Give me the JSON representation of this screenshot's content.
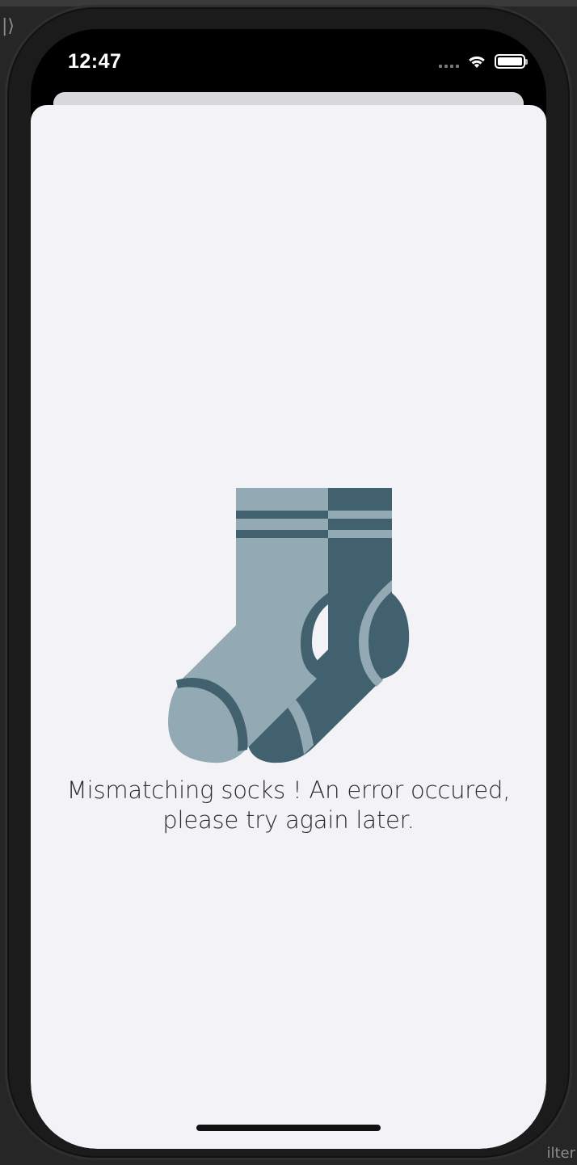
{
  "status_bar": {
    "time": "12:47",
    "signal_icon": "signal-dots-icon",
    "wifi_icon": "wifi-icon",
    "battery_icon": "battery-full-icon"
  },
  "error_state": {
    "illustration_icon": "mismatched-socks-icon",
    "message_line1": "Mismatching socks ! An error occured,",
    "message_line2": "please try again later."
  },
  "colors": {
    "sheet_background": "#f2f2f7",
    "sock_light": "#93aab4",
    "sock_dark": "#42616f"
  },
  "background": {
    "left_glyph": "|⟩",
    "right_text": "ilter"
  }
}
